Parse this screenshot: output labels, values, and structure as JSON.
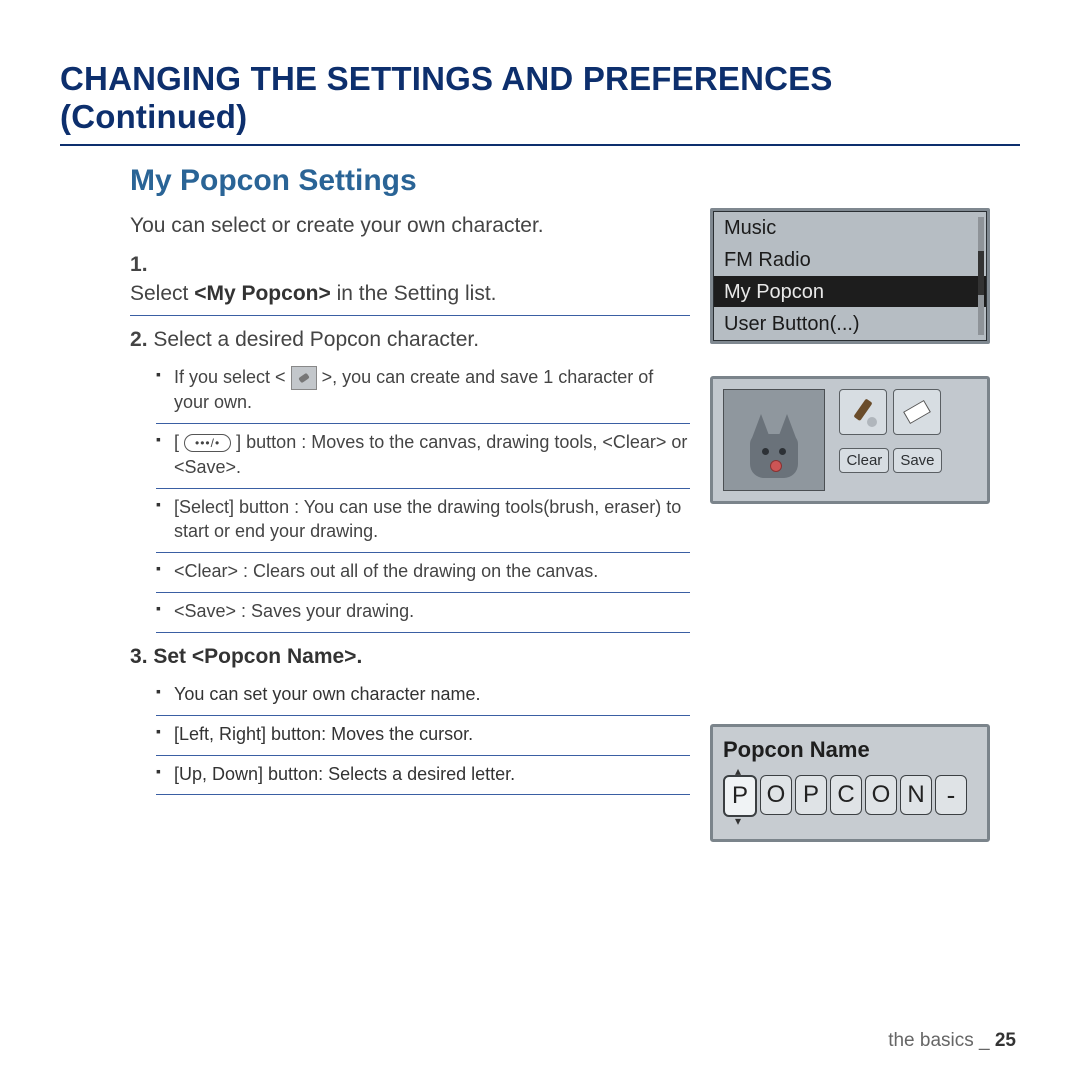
{
  "title": "CHANGING THE SETTINGS AND PREFERENCES (Continued)",
  "section": "My Popcon Settings",
  "intro": "You can select or create your own character.",
  "step1": {
    "prefix": "Select ",
    "bold": "<My Popcon>",
    "suffix": " in the Setting list."
  },
  "step2": "Select a desired Popcon character.",
  "b1a": "If you select < ",
  "b1b": " >, you can create and save 1 character of your own.",
  "b2a": "[ ",
  "pill": "•••/•",
  "b2b": " ] button : Moves to the canvas, drawing tools, <Clear> or <Save>.",
  "b3": "[Select] button : You can use the drawing tools(brush, eraser) to start or end your drawing.",
  "b4": "<Clear> : Clears out all of the drawing on the canvas.",
  "b5": "<Save> : Saves your drawing.",
  "step3": {
    "prefix": "Set ",
    "bold": "<Popcon Name>",
    "suffix": "."
  },
  "c1": "You can set your own character name.",
  "c2": "[Left, Right] button: Moves the cursor.",
  "c3": "[Up, Down] button: Selects a desired letter.",
  "menu": {
    "i0": "Music",
    "i1": "FM Radio",
    "i2": "My Popcon",
    "i3": "User Button(...)"
  },
  "draw": {
    "clear": "Clear",
    "save": "Save"
  },
  "name": {
    "title": "Popcon Name",
    "l0": "P",
    "l1": "O",
    "l2": "P",
    "l3": "C",
    "l4": "O",
    "l5": "N",
    "l6": "-"
  },
  "footer": {
    "section": "the basics _ ",
    "page": "25"
  }
}
